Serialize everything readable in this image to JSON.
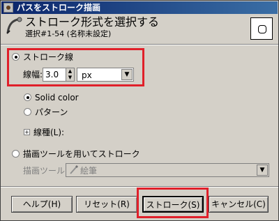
{
  "window": {
    "title": "パスをストローク描画"
  },
  "header": {
    "title": "ストローク形式を選択する",
    "subtitle": "選択#1-54 (名称未設定)"
  },
  "stroke_line": {
    "label": "ストローク線",
    "selected": true,
    "width_label": "線幅:",
    "width_value": "3.0",
    "unit": "px"
  },
  "fill": {
    "solid_color_label": "Solid color",
    "solid_color_selected": true,
    "pattern_label": "パターン",
    "pattern_selected": false
  },
  "line_style": {
    "label": "線種(L):"
  },
  "paint_tool": {
    "label": "描画ツールを用いてストローク",
    "selected": false,
    "tool_label": "描画ツール:",
    "tool_value": "絵筆"
  },
  "buttons": {
    "help": "ヘルプ(H)",
    "reset": "リセット(R)",
    "stroke": "ストローク(S)",
    "cancel": "キャンセル(C)"
  },
  "colors": {
    "highlight": "#e0202a",
    "titlebar": "#0a246a"
  }
}
